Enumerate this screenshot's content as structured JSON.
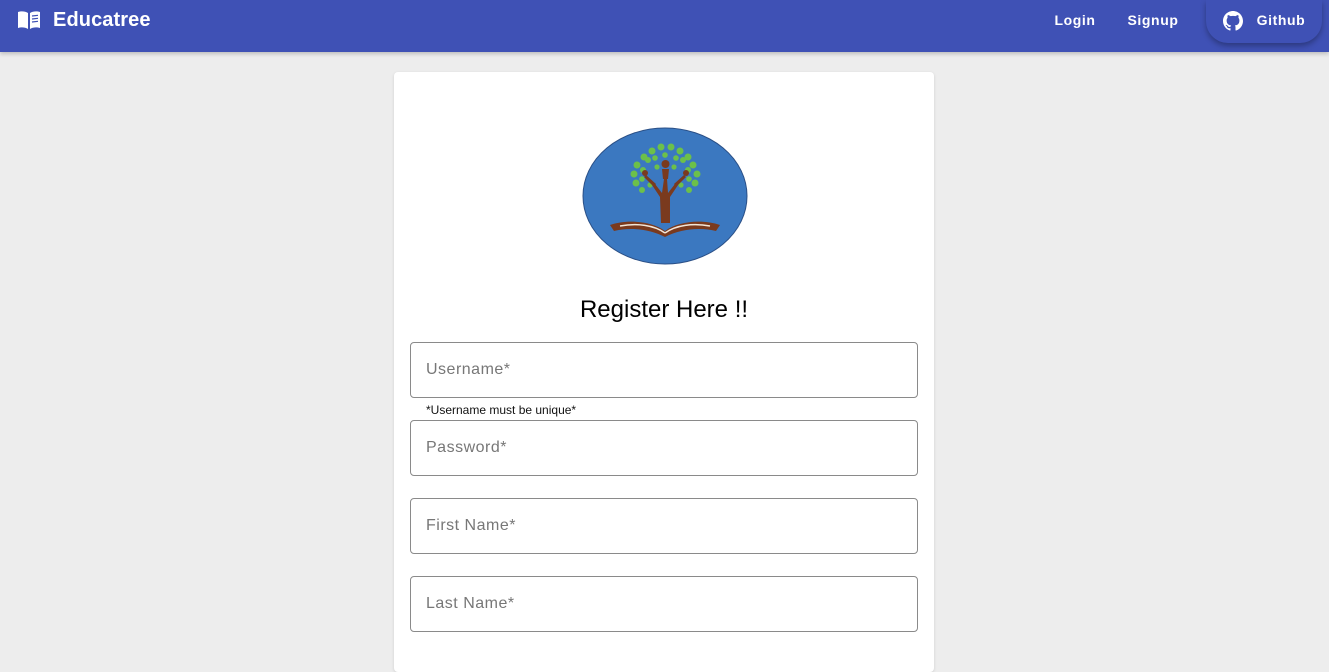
{
  "appbar": {
    "title": "Educatree",
    "brand_icon": "open-book-icon",
    "color": "#3f51b5",
    "nav": {
      "login": "Login",
      "signup": "Signup",
      "github": "Github",
      "github_icon": "github-icon"
    }
  },
  "form": {
    "heading": "Register Here !!",
    "logo_icon": "educatree-tree-book-logo",
    "username": {
      "placeholder": "Username*",
      "helper": "*Username must be unique*"
    },
    "password": {
      "placeholder": "Password*"
    },
    "first_name": {
      "placeholder": "First Name*"
    },
    "last_name": {
      "placeholder": "Last Name*"
    }
  }
}
